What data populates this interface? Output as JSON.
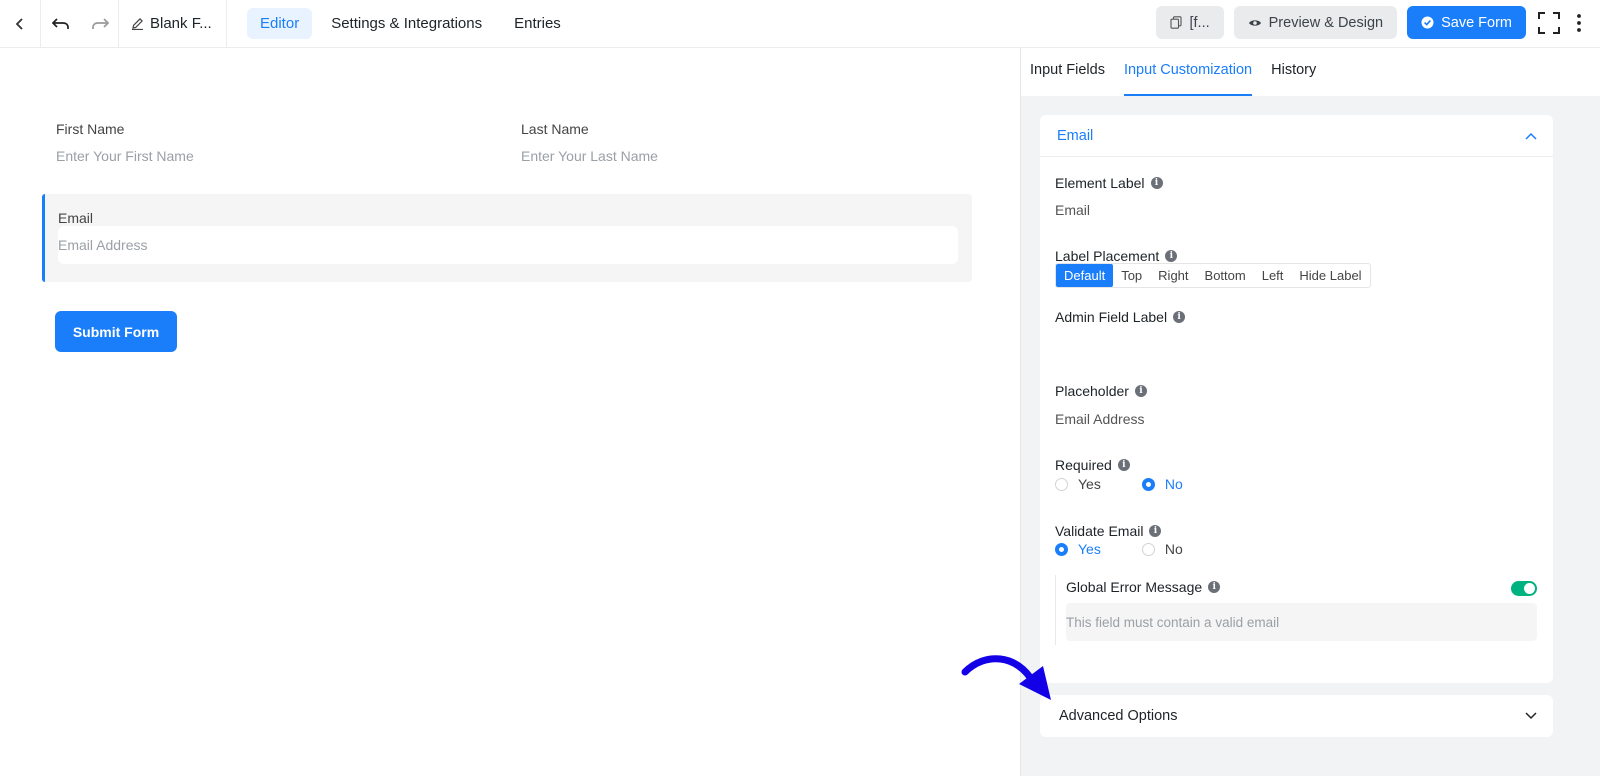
{
  "topbar": {
    "title": "Blank F...",
    "tabs": [
      {
        "label": "Editor",
        "active": true
      },
      {
        "label": "Settings & Integrations",
        "active": false
      },
      {
        "label": "Entries",
        "active": false
      }
    ],
    "shortcode_label": "[f...",
    "preview_label": "Preview & Design",
    "save_label": "Save Form"
  },
  "form": {
    "first_name_label": "First Name",
    "first_name_placeholder": "Enter Your First Name",
    "last_name_label": "Last Name",
    "last_name_placeholder": "Enter Your Last Name",
    "email_label": "Email",
    "email_placeholder": "Email Address",
    "submit_label": "Submit Form"
  },
  "sidebar": {
    "tabs": [
      {
        "label": "Input Fields",
        "active": false
      },
      {
        "label": "Input Customization",
        "active": true
      },
      {
        "label": "History",
        "active": false
      }
    ],
    "panel_title": "Email",
    "element_label": {
      "label": "Element Label",
      "value": "Email"
    },
    "label_placement": {
      "label": "Label Placement",
      "options": [
        "Default",
        "Top",
        "Right",
        "Bottom",
        "Left",
        "Hide Label"
      ],
      "selected": "Default"
    },
    "admin_field_label": {
      "label": "Admin Field Label",
      "value": ""
    },
    "placeholder": {
      "label": "Placeholder",
      "value": "Email Address"
    },
    "required": {
      "label": "Required",
      "yes": "Yes",
      "no": "No",
      "selected": "No"
    },
    "validate_email": {
      "label": "Validate Email",
      "yes": "Yes",
      "no": "No",
      "selected": "Yes"
    },
    "global_error": {
      "label": "Global Error Message",
      "enabled": true,
      "placeholder": "This field must contain a valid email"
    },
    "advanced_label": "Advanced Options"
  },
  "colors": {
    "accent": "#1a7efb",
    "toggle_on": "#00b27f",
    "annotation_arrow": "#1400e6"
  }
}
